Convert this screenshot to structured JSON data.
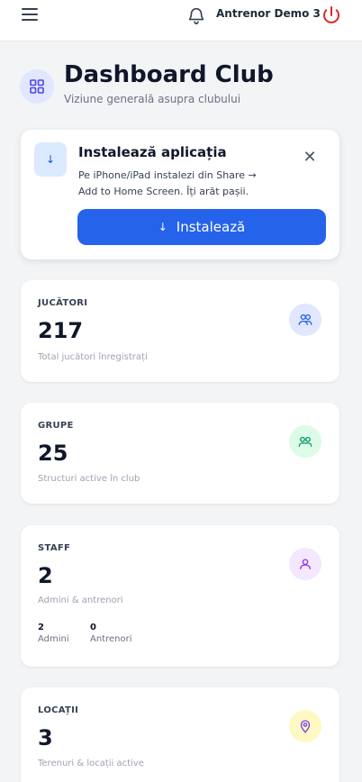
{
  "topbar": {
    "user_name": "Antrenor Demo 3"
  },
  "header": {
    "title": "Dashboard Club",
    "subtitle": "Viziune generală asupra clubului"
  },
  "install": {
    "title": "Instalează aplicația",
    "text": "Pe iPhone/iPad instalezi din Share → Add to Home Screen. Îți arăt pașii.",
    "button_label": "Instalează",
    "icon_glyph": "↓",
    "close_glyph": "✕"
  },
  "stats": [
    {
      "label": "JUCĂTORI",
      "value": "217",
      "sub": "Total jucători înregistrați",
      "icon": "users-icon",
      "icon_color": "#2563eb",
      "icon_bg": "#e0e7ff"
    },
    {
      "label": "GRUPE",
      "value": "25",
      "sub": "Structuri active în club",
      "icon": "groups-icon",
      "icon_color": "#059669",
      "icon_bg": "#dcfce7"
    },
    {
      "label": "STAFF",
      "value": "2",
      "sub": "Admini & antrenori",
      "icon": "user-icon",
      "icon_color": "#9333ea",
      "icon_bg": "#f3e8ff",
      "breakdown": [
        {
          "num": "2",
          "label": "Admini"
        },
        {
          "num": "0",
          "label": "Antrenori"
        }
      ]
    },
    {
      "label": "LOCAȚII",
      "value": "3",
      "sub": "Terenuri & locații active",
      "icon": "map-pin-icon",
      "icon_color": "#7c3aed",
      "icon_bg": "#fef9c3"
    }
  ],
  "colors": {
    "accent": "#2563eb",
    "power": "#dc2626"
  }
}
